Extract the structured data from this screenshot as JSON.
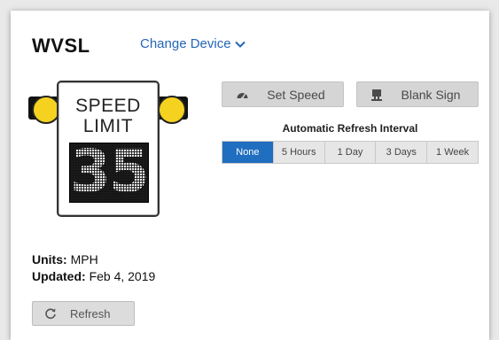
{
  "header": {
    "device_name": "WVSL",
    "change_device_label": "Change Device"
  },
  "sign": {
    "line1": "SPEED",
    "line2": "LIMIT",
    "speed_value": "35",
    "lamp_color": "#f4d21f"
  },
  "actions": {
    "set_speed_label": "Set Speed",
    "set_speed_icon": "speedometer-icon",
    "blank_sign_label": "Blank Sign",
    "blank_sign_icon": "sign-icon"
  },
  "refresh_interval": {
    "caption": "Automatic Refresh Interval",
    "options": [
      "None",
      "5 Hours",
      "1 Day",
      "3 Days",
      "1 Week"
    ],
    "selected": "None",
    "active_color": "#1f6ec0"
  },
  "status": {
    "units_label": "Units:",
    "units_value": "MPH",
    "updated_label": "Updated:",
    "updated_value": "Feb 4, 2019"
  },
  "refresh_button": {
    "label": "Refresh",
    "icon": "refresh-icon"
  }
}
